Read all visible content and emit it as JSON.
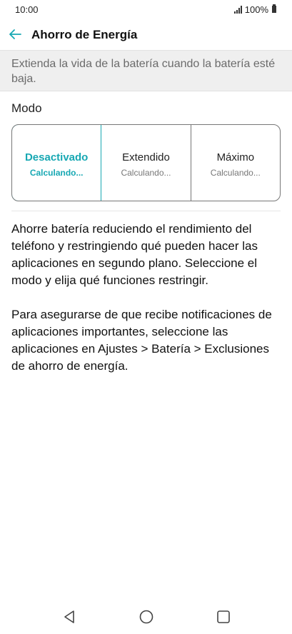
{
  "status_bar": {
    "time": "10:00",
    "battery": "100%"
  },
  "app_bar": {
    "title": "Ahorro de Energía"
  },
  "banner": {
    "text": "Extienda la vida de la batería cuando la batería esté baja."
  },
  "mode": {
    "label": "Modo",
    "options": [
      {
        "name": "Desactivado",
        "sub": "Calculando...",
        "selected": true
      },
      {
        "name": "Extendido",
        "sub": "Calculando...",
        "selected": false
      },
      {
        "name": "Máximo",
        "sub": "Calculando...",
        "selected": false
      }
    ]
  },
  "description": {
    "paragraph_1": "Ahorre batería reduciendo el rendimiento del teléfono y restringiendo qué pueden hacer las aplicaciones en segundo plano. Seleccione el modo y elija qué funciones restringir.",
    "paragraph_2": "Para asegurarse de que recibe notificaciones de aplicaciones importantes, seleccione las aplicaciones en Ajustes > Batería > Exclusiones de ahorro de energía."
  },
  "colors": {
    "accent": "#17a8b3",
    "banner_bg": "#efefef"
  },
  "icons": {
    "back": "arrow-left-icon",
    "nav_back": "triangle-back-icon",
    "nav_home": "circle-home-icon",
    "nav_recents": "square-recents-icon"
  }
}
